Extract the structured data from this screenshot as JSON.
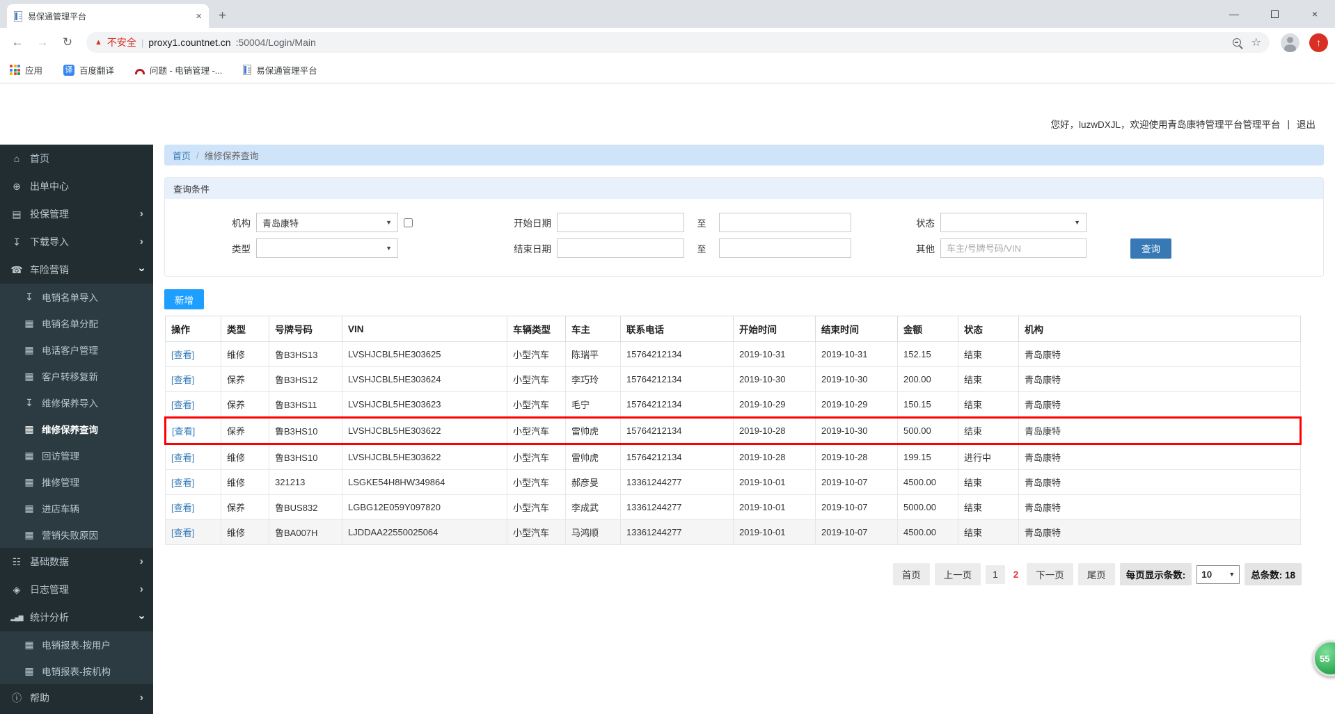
{
  "browser": {
    "tab_title": "易保通管理平台",
    "security_warning": "不安全",
    "url_host": "proxy1.countnet.cn",
    "url_path": ":50004/Login/Main",
    "bookmarks": [
      {
        "icon": "apps-grid-icon",
        "label": "应用"
      },
      {
        "icon": "translate-icon",
        "glyph": "译",
        "label": "百度翻译"
      },
      {
        "icon": "redmine-icon",
        "label": "问题 - 电销管理 -..."
      },
      {
        "icon": "site-icon",
        "label": "易保通管理平台"
      }
    ],
    "icons": {
      "back": "←",
      "forward": "→",
      "reload": "↻",
      "warning": "▲",
      "url_separator": "|",
      "star": "☆",
      "update_arrow": "↑",
      "minimize": "—",
      "close": "×",
      "tab_close": "×",
      "new_tab": "+"
    }
  },
  "header": {
    "greeting": "您好，luzwDXJL，欢迎使用青岛康特管理平台管理平台",
    "separator": "|",
    "logout": "退出"
  },
  "sidebar": {
    "items": [
      {
        "icon": "home-icon",
        "glyph": "⌂",
        "label": "首页"
      },
      {
        "icon": "globe-icon",
        "glyph": "⊕",
        "label": "出单中心"
      },
      {
        "icon": "document-icon",
        "glyph": "▤",
        "label": "投保管理",
        "arrow": "right"
      },
      {
        "icon": "download-icon",
        "glyph": "↧",
        "label": "下载导入",
        "arrow": "right"
      },
      {
        "icon": "phone-icon",
        "glyph": "☎",
        "label": "车险营销",
        "arrow": "down",
        "children": [
          {
            "icon": "download-icon",
            "glyph": "↧",
            "label": "电销名单导入"
          },
          {
            "icon": "grid-icon",
            "glyph": "▦",
            "label": "电销名单分配"
          },
          {
            "icon": "grid-icon",
            "glyph": "▦",
            "label": "电话客户管理"
          },
          {
            "icon": "grid-icon",
            "glyph": "▦",
            "label": "客户转移复新"
          },
          {
            "icon": "download-icon",
            "glyph": "↧",
            "label": "维修保养导入"
          },
          {
            "icon": "grid-icon",
            "glyph": "▦",
            "label": "维修保养查询",
            "active": true
          },
          {
            "icon": "grid-icon",
            "glyph": "▦",
            "label": "回访管理"
          },
          {
            "icon": "grid-icon",
            "glyph": "▦",
            "label": "推修管理"
          },
          {
            "icon": "grid-icon",
            "glyph": "▦",
            "label": "进店车辆"
          },
          {
            "icon": "grid-icon",
            "glyph": "▦",
            "label": "营销失败原因"
          }
        ]
      },
      {
        "icon": "database-icon",
        "glyph": "☷",
        "label": "基础数据",
        "arrow": "right"
      },
      {
        "icon": "tag-icon",
        "glyph": "◈",
        "label": "日志管理",
        "arrow": "right"
      },
      {
        "icon": "bar-chart-icon",
        "glyph": "▂▄▆",
        "label": "统计分析",
        "arrow": "down",
        "children": [
          {
            "icon": "grid-icon",
            "glyph": "▦",
            "label": "电销报表-按用户"
          },
          {
            "icon": "grid-icon",
            "glyph": "▦",
            "label": "电销报表-按机构"
          }
        ]
      },
      {
        "icon": "info-icon",
        "glyph": "ⓘ",
        "label": "帮助",
        "arrow": "right"
      }
    ]
  },
  "breadcrumb": {
    "home": "首页",
    "separator": "/",
    "current": "维修保养查询"
  },
  "query": {
    "title": "查询条件",
    "org_label": "机构",
    "org_value": "青岛康特",
    "type_label": "类型",
    "type_value": "",
    "start_date_label": "开始日期",
    "end_date_label": "结束日期",
    "to_label": "至",
    "status_label": "状态",
    "status_value": "",
    "other_label": "其他",
    "other_placeholder": "车主/号牌号码/VIN",
    "search_button": "查询",
    "caret": "▼"
  },
  "table": {
    "add_button": "新增",
    "action_label": "[查看]",
    "headers": [
      "操作",
      "类型",
      "号牌号码",
      "VIN",
      "车辆类型",
      "车主",
      "联系电话",
      "开始时间",
      "结束时间",
      "金额",
      "状态",
      "机构"
    ],
    "rows": [
      {
        "type": "维修",
        "plate": "鲁B3HS13",
        "vin": "LVSHJCBL5HE303625",
        "vehicle_type": "小型汽车",
        "owner": "陈瑞平",
        "phone": "15764212134",
        "start_time": "2019-10-31",
        "end_time": "2019-10-31",
        "amount": "152.15",
        "status": "结束",
        "org": "青岛康特"
      },
      {
        "type": "保养",
        "plate": "鲁B3HS12",
        "vin": "LVSHJCBL5HE303624",
        "vehicle_type": "小型汽车",
        "owner": "李巧玲",
        "phone": "15764212134",
        "start_time": "2019-10-30",
        "end_time": "2019-10-30",
        "amount": "200.00",
        "status": "结束",
        "org": "青岛康特"
      },
      {
        "type": "保养",
        "plate": "鲁B3HS11",
        "vin": "LVSHJCBL5HE303623",
        "vehicle_type": "小型汽车",
        "owner": "毛宁",
        "phone": "15764212134",
        "start_time": "2019-10-29",
        "end_time": "2019-10-29",
        "amount": "150.15",
        "status": "结束",
        "org": "青岛康特"
      },
      {
        "type": "保养",
        "plate": "鲁B3HS10",
        "vin": "LVSHJCBL5HE303622",
        "vehicle_type": "小型汽车",
        "owner": "雷帅虎",
        "phone": "15764212134",
        "start_time": "2019-10-28",
        "end_time": "2019-10-30",
        "amount": "500.00",
        "status": "结束",
        "org": "青岛康特",
        "highlight": true
      },
      {
        "type": "维修",
        "plate": "鲁B3HS10",
        "vin": "LVSHJCBL5HE303622",
        "vehicle_type": "小型汽车",
        "owner": "雷帅虎",
        "phone": "15764212134",
        "start_time": "2019-10-28",
        "end_time": "2019-10-28",
        "amount": "199.15",
        "status": "进行中",
        "org": "青岛康特"
      },
      {
        "type": "维修",
        "plate": "321213",
        "vin": "LSGKE54H8HW349864",
        "vehicle_type": "小型汽车",
        "owner": "郝彦旻",
        "phone": "13361244277",
        "start_time": "2019-10-01",
        "end_time": "2019-10-07",
        "amount": "4500.00",
        "status": "结束",
        "org": "青岛康特"
      },
      {
        "type": "保养",
        "plate": "鲁BUS832",
        "vin": "LGBG12E059Y097820",
        "vehicle_type": "小型汽车",
        "owner": "李成武",
        "phone": "13361244277",
        "start_time": "2019-10-01",
        "end_time": "2019-10-07",
        "amount": "5000.00",
        "status": "结束",
        "org": "青岛康特"
      },
      {
        "type": "维修",
        "plate": "鲁BA007H",
        "vin": "LJDDAA22550025064",
        "vehicle_type": "小型汽车",
        "owner": "马鸿顺",
        "phone": "13361244277",
        "start_time": "2019-10-01",
        "end_time": "2019-10-07",
        "amount": "4500.00",
        "status": "结束",
        "org": "青岛康特",
        "shaded": true
      }
    ]
  },
  "pagination": {
    "first": "首页",
    "prev": "上一页",
    "page1": "1",
    "current": "2",
    "next": "下一页",
    "last": "尾页",
    "per_page_label": "每页显示条数:",
    "per_page_value": "10",
    "caret": "▼",
    "total_label": "总条数: 18"
  },
  "floating_badge": "55",
  "colors": {
    "add_button_blue": "#1e9fff",
    "search_button_blue": "#3679b5",
    "sidebar_bg": "#222d32",
    "submenu_bg": "#2c3b41",
    "breadcrumb_bg": "#cfe3f9",
    "panel_header_bg": "#e7f0fb",
    "highlight_row_red": "#ff0000",
    "current_page_red": "#e4393c",
    "warning_red": "#d93025",
    "link_blue": "#337ab7"
  }
}
